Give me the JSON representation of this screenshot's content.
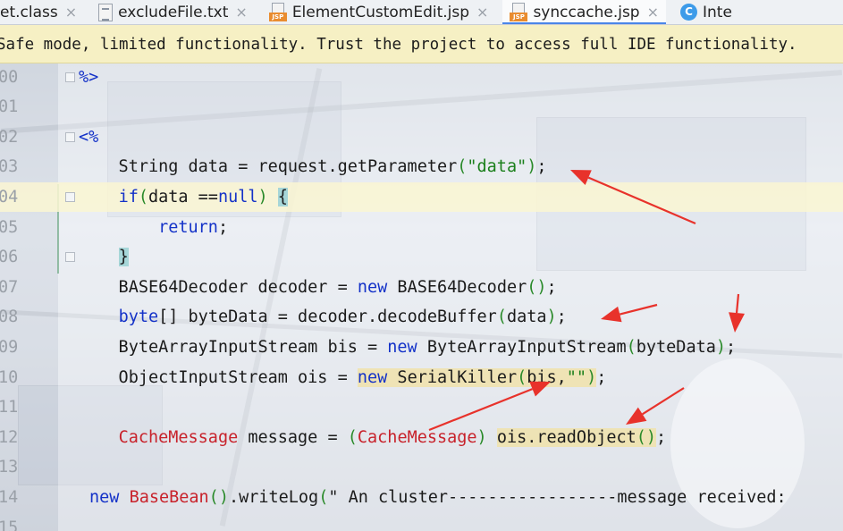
{
  "tabs": [
    {
      "label": "et.class",
      "icon": "",
      "active": false
    },
    {
      "label": "excludeFile.txt",
      "icon": "text-file-icon",
      "active": false
    },
    {
      "label": "ElementCustomEdit.jsp",
      "icon": "jsp-file-icon",
      "active": false
    },
    {
      "label": "synccache.jsp",
      "icon": "jsp-file-icon",
      "active": true
    },
    {
      "label": "Inte",
      "icon": "class-icon",
      "active": false
    }
  ],
  "tab_close_glyph": "×",
  "jsp_badge": "JSP",
  "class_badge": "C",
  "banner": {
    "text": "Safe mode, limited functionality. Trust the project to access full IDE functionality."
  },
  "editor": {
    "line_numbers": [
      "00",
      "01",
      "02",
      "03",
      "04",
      "05",
      "06",
      "07",
      "08",
      "09",
      "10",
      "11",
      "12",
      "13",
      "14",
      "15"
    ],
    "current_line": "04",
    "lines": [
      "%>",
      "",
      "<%",
      "    String data = request.getParameter(\"data\");",
      "    if(data ==null) {",
      "        return;",
      "    }",
      "    BASE64Decoder decoder = new BASE64Decoder();",
      "    byte[] byteData = decoder.decodeBuffer(data);",
      "    ByteArrayInputStream bis = new ByteArrayInputStream(byteData);",
      "    ObjectInputStream ois = new SerialKiller(bis,\"\");",
      "",
      "    CacheMessage message = (CacheMessage) ois.readObject();",
      "",
      "new BaseBean().writeLog(\" An cluster-----------------message received:",
      ""
    ],
    "annotation_color": "#e8322b"
  }
}
